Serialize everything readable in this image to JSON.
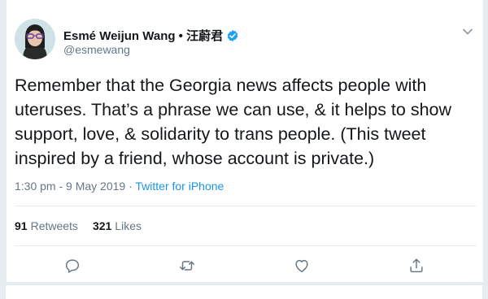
{
  "author": {
    "display_name": "Esmé Weijun Wang • 汪蔚君",
    "handle": "@esmewang",
    "verified": true
  },
  "tweet": {
    "text": "Remember that the Georgia news affects people with uteruses. That’s a phrase we can use, & it helps to show support, love, & solidarity to trans people. (This tweet inspired by a friend, whose account is private.)",
    "timestamp": "1:30 pm - 9 May 2019",
    "separator": " · ",
    "source": "Twitter for iPhone"
  },
  "stats": {
    "retweets_count": "91",
    "retweets_label": "Retweets",
    "likes_count": "321",
    "likes_label": "Likes"
  },
  "icons": {
    "verified": "verified-badge-icon",
    "menu": "chevron-down-icon",
    "reply": "reply-icon",
    "retweet": "retweet-icon",
    "like": "heart-icon",
    "share": "share-icon"
  },
  "colors": {
    "accent": "#1da1f2",
    "link": "#1b95e0",
    "secondary_text": "#657786",
    "background": "#e6ecf0"
  }
}
